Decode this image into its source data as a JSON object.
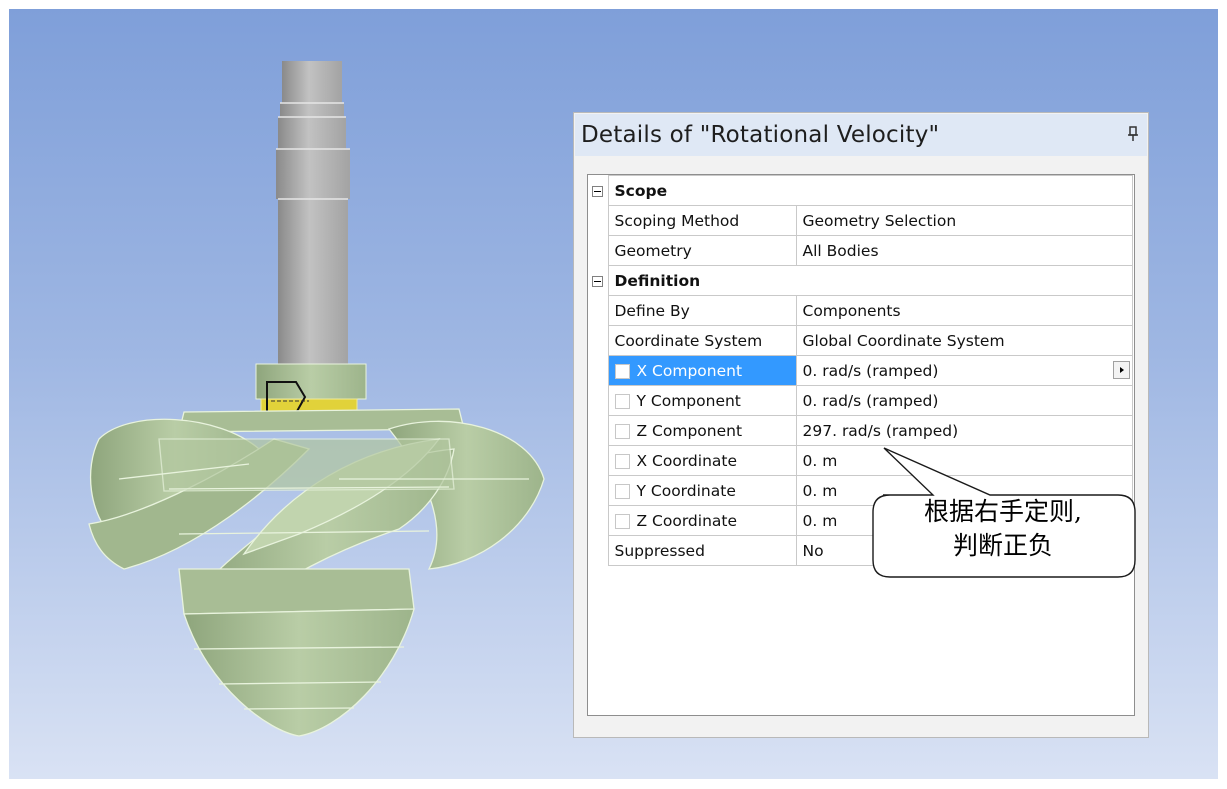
{
  "panel": {
    "title": "Details of \"Rotational Velocity\""
  },
  "groups": [
    {
      "name": "Scope",
      "rows": [
        {
          "label": "Scoping Method",
          "value": "Geometry Selection"
        },
        {
          "label": "Geometry",
          "value": "All Bodies"
        }
      ]
    },
    {
      "name": "Definition",
      "rows": [
        {
          "label": "Define By",
          "value": "Components"
        },
        {
          "label": "Coordinate System",
          "value": "Global Coordinate System"
        },
        {
          "label": "X Component",
          "value": "0. rad/s  (ramped)"
        },
        {
          "label": "Y Component",
          "value": "0. rad/s  (ramped)"
        },
        {
          "label": "Z Component",
          "value": "297. rad/s  (ramped)"
        },
        {
          "label": "X Coordinate",
          "value": "0. m"
        },
        {
          "label": "Y Coordinate",
          "value": "0. m"
        },
        {
          "label": "Z Coordinate",
          "value": "0. m"
        },
        {
          "label": "Suppressed",
          "value": "No"
        }
      ]
    }
  ],
  "annotation": {
    "line1": "根据右手定则,",
    "line2": "判断正负"
  },
  "colors": {
    "selection": "#3399ff",
    "model_green": "#b6cca0",
    "selected_face": "#e4d83a"
  }
}
